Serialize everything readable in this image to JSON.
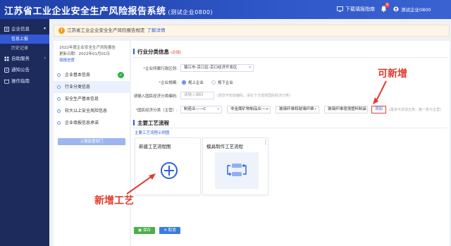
{
  "header": {
    "title": "江苏省工业企业安全生产风险报告系统",
    "subtitle": "(测试企业0800)",
    "guide_label": "下载填报指南",
    "badge_count": "6",
    "user_name": "测试企业0800"
  },
  "sidebar": {
    "groups": [
      {
        "label": "企业信息",
        "icon": "building-icon",
        "items": [
          "信息上报",
          "历史记录"
        ]
      },
      {
        "label": "自助服务",
        "icon": "service-icon",
        "items": []
      },
      {
        "label": "通知公告",
        "icon": "notice-icon",
        "items": []
      },
      {
        "label": "操作指南",
        "icon": "guide-icon",
        "items": []
      }
    ],
    "active_item": "信息上报"
  },
  "notice": {
    "text": "江苏省工业企业安全生产风险报告规定",
    "link": "了解详情"
  },
  "left_panel": {
    "year_title": "2022年度企业安全生产风险报告",
    "updated": "更新日期：2022年01月01日",
    "fill_label": "填报进度",
    "steps": [
      {
        "label": "企业基本信息",
        "done": true
      },
      {
        "label": "行业分类信息",
        "done": false
      },
      {
        "label": "安全生产基本信息",
        "done": false
      },
      {
        "label": "较大以上安全风险信息",
        "done": false
      },
      {
        "label": "企业填报信息承诺",
        "done": false
      }
    ],
    "submit_label": "上报监管部门"
  },
  "industry": {
    "title": "行业分类信息",
    "required_tag": "(必填)",
    "region_label": "企业所属行政区划:",
    "region_value": "镇江市-京口区-京口经济开发区",
    "scale_label": "企业规模:",
    "scale_options": [
      "规上企业",
      "规下企业"
    ],
    "scale_selected": "规上企业",
    "econ_code_label": "请输入国民经济分类编码:",
    "econ_code_placeholder": "请输入编码",
    "econ_code_hint": "(若您不知道编码，请在下方选择国民经济分类)",
    "econ_class_label": "国民经济分类（主营）:",
    "econ_class_values": [
      "制造业——C",
      "非金属矿物制品业——",
      "玻璃纤维和玻璃纤维",
      "玻璃纤维增强塑料制品"
    ],
    "add_label": "添加",
    "add_hint": "(最多可添加五条，第一条为主营)"
  },
  "process": {
    "title": "主要工艺流程",
    "example_link": "主要工艺流程示例图",
    "cards": [
      {
        "title": "新建工艺流程图",
        "icon": "plus-circle-icon"
      },
      {
        "title": "模具制作工艺流程",
        "icon": "flow-icon"
      }
    ]
  },
  "buttons": {
    "save": "保存",
    "cancel": "取消"
  },
  "annotations": {
    "add_note": "可新增",
    "new_process_note": "新增工艺"
  },
  "colors": {
    "header_blue": "#2f57c8",
    "sidebar_bg": "#1d2b5c",
    "accent_blue": "#2f60d8",
    "annotation_red": "#e23b2e",
    "save_green": "#4cae4c"
  }
}
